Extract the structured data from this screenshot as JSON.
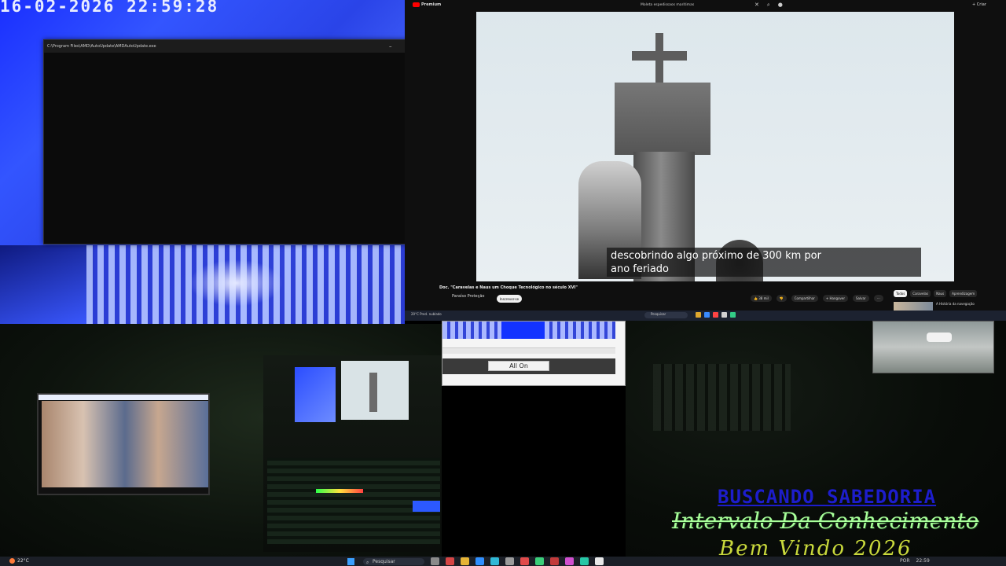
{
  "camera_top_left": {
    "timestamp": "16-02-2026  22:59:28"
  },
  "console_window": {
    "title": "C:\\Program Files\\AMD\\AutoUpdate\\AMDAutoUpdate.exe",
    "controls": [
      "–",
      "□",
      "✕"
    ]
  },
  "youtube": {
    "logo_text": "Premium",
    "search_text": "Moleta espedissaos maritimas",
    "create_label": "+ Criar",
    "subtitle_line1": "descobrindo algo próximo de 300 km por",
    "subtitle_line2": "ano feriado",
    "video_title": "Doc. \"Caravelas e Naus um Choque Tecnológico no século XVI\"",
    "channel_name": "Paraíso Proteção",
    "subscribe_label": "Inscrever-se",
    "actions": [
      "👍 38 mil",
      "👎",
      "Compartilhar",
      "+ Hangover",
      "Salvar",
      "⋯"
    ],
    "chips": [
      "Todos",
      "Caravelas",
      "Naus",
      "Aprendizagem"
    ],
    "related_title": "A História da navegação"
  },
  "mini_taskbar": {
    "weather": "20°C Pred. nublado",
    "search_placeholder": "Pesquisar"
  },
  "mid_window": {
    "button_label": "All On"
  },
  "overlay": {
    "line1": "BUSCANDO SABEDORIA",
    "line2": "Intervalo Da Conhecimento",
    "line3": "Bem Vindo 2026"
  },
  "taskbar": {
    "weather": "22°C",
    "search_placeholder": "Pesquisar",
    "tray_lang": "POR",
    "tray_time": "22:59"
  },
  "colors": {
    "youtube_red": "#ff0000",
    "overlay_blue": "#1d1dcc",
    "overlay_green": "#a8ff9a",
    "overlay_yellow": "#c9d93c"
  }
}
